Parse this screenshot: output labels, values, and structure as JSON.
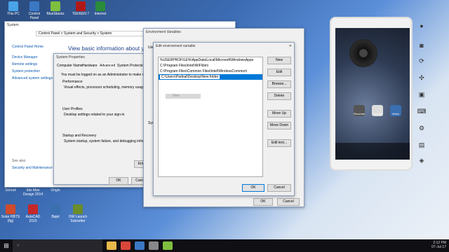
{
  "desktop_icons": [
    {
      "label": "This PC"
    },
    {
      "label": "Control Panel"
    },
    {
      "label": "BlueStacks"
    },
    {
      "label": "TEKKEN 7"
    },
    {
      "label": "Internet"
    },
    {
      "label": "School"
    },
    {
      "label": "3ds Max Design 2014"
    },
    {
      "label": "Origin"
    },
    {
      "label": "Solar HBTS (fig)"
    },
    {
      "label": "AutoCAD 2015"
    },
    {
      "label": "Bajel"
    },
    {
      "label": "OW Launch Subsetter"
    }
  ],
  "system_window": {
    "title": "System",
    "address": "Control Panel  >  System and Security  >  System",
    "home": "Control Panel Home",
    "links": [
      "Device Manager",
      "Remote settings",
      "System protection",
      "Advanced system settings"
    ],
    "see_also": "See also",
    "security": "Security and Maintenance",
    "heading": "View basic information about your computer"
  },
  "system_properties": {
    "title": "System Properties",
    "tabs": [
      "Computer Name",
      "Hardware",
      "Advanced",
      "System Protection"
    ],
    "note": "You must be logged on as an Administrator to make most",
    "performance_title": "Performance",
    "performance_text": "Visual effects, processor scheduling, memory usage, and",
    "profiles_title": "User Profiles",
    "profiles_text": "Desktop settings related to your sign-in",
    "startup_title": "Startup and Recovery",
    "startup_text": "System startup, system failure, and debugging information",
    "env_button": "Env",
    "ok": "OK",
    "cancel": "Cancel"
  },
  "env_window": {
    "title": "Environment Variables",
    "user_label": "User",
    "system_label": "Syst",
    "ok": "OK",
    "cancel": "Cancel"
  },
  "edit_dialog": {
    "title": "Edit environment variable",
    "entries": [
      "%USERPROFILE%\\AppData\\Local\\Microsoft\\WindowsApps",
      "C:\\Program Files\\Intel\\WiFi\\bin\\",
      "C:\\Program Files\\Common Files\\Intel\\WirelessCommon\\",
      "C:\\Users\\Padnal\\Desktop\\New folder"
    ],
    "ghost": "New",
    "buttons": {
      "new": "New",
      "edit": "Edit",
      "browse": "Browse...",
      "delete": "Delete",
      "move_up": "Move Up",
      "move_down": "Move Down",
      "edit_text": "Edit text..."
    },
    "ok": "OK",
    "cancel": "Cancel"
  },
  "phone": {
    "dock": [
      "Recorder",
      "Camera",
      "Video"
    ]
  },
  "taskbar": {
    "search_placeholder": "Search",
    "time": "2:12 PM",
    "date": "07-Jul-17"
  }
}
